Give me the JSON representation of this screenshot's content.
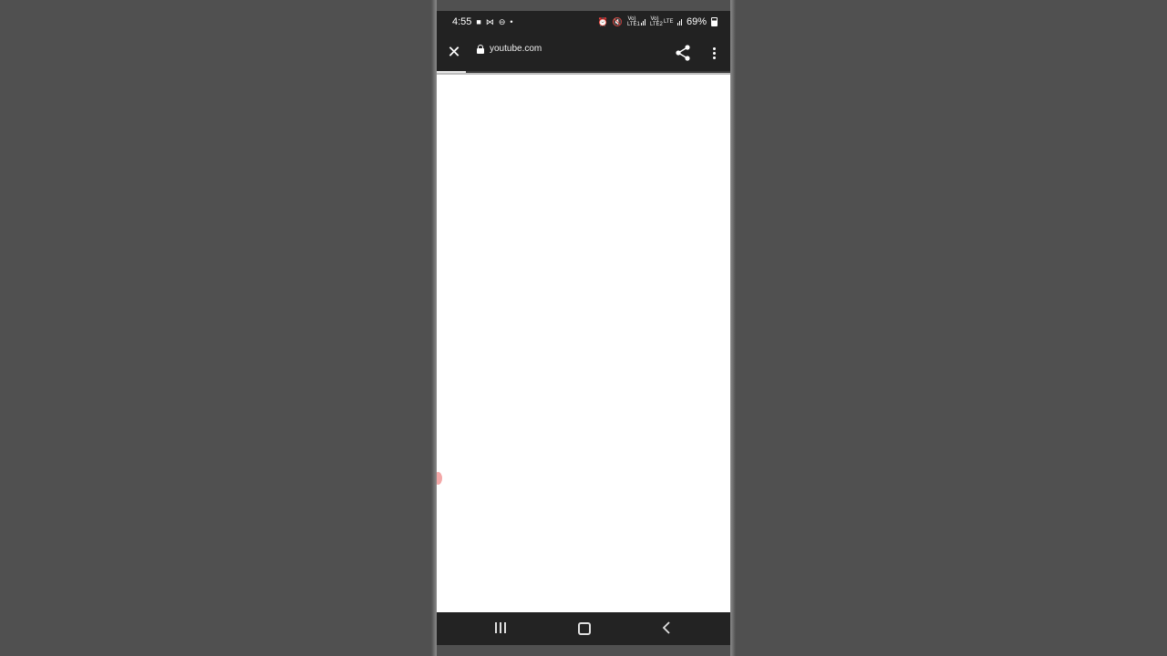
{
  "status_bar": {
    "time": "4:55",
    "battery": "69%",
    "battery_level": 0.69,
    "left_icons": [
      "video-camera-icon",
      "mail-icon",
      "do-not-disturb-icon",
      "dot-icon"
    ],
    "right_icons": [
      "alarm-icon",
      "mute-icon",
      "signal-icon",
      "volte-icon",
      "signal-icon",
      "battery-icon"
    ],
    "volte_1": "Vo) LTE1",
    "volte_2": "Vo) LTE2",
    "lte_label": "LTE"
  },
  "browser": {
    "url": "youtube.com",
    "load_progress": 0.1,
    "icons": [
      "close-icon",
      "lock-icon",
      "share-icon",
      "more-vert-icon"
    ]
  },
  "nav_bar": {
    "icons": [
      "recent-apps-icon",
      "home-icon",
      "back-icon"
    ]
  },
  "colors": {
    "background": "#505050",
    "toolbar": "#222222",
    "page": "#ffffff",
    "edge_indicator": "#f3a7a7"
  }
}
